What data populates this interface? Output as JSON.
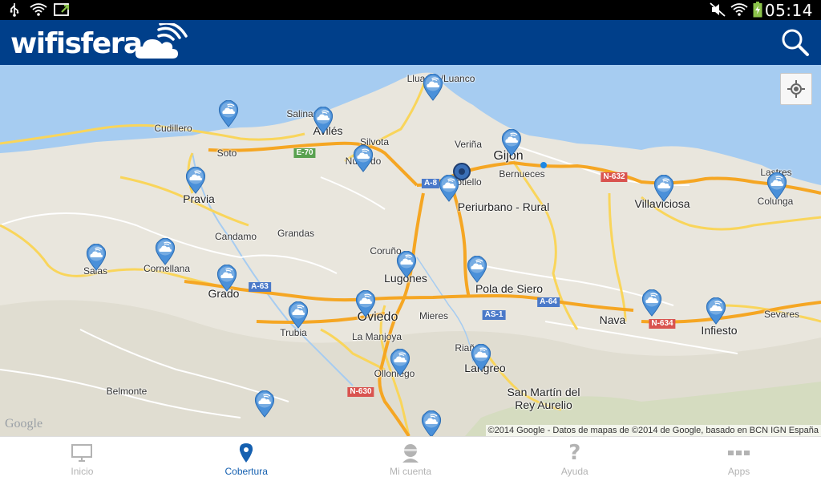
{
  "status_bar": {
    "time": "05:14",
    "left_icons": [
      "usb-icon",
      "wifi-alert-icon",
      "screen-share-icon"
    ],
    "right_icons": [
      "mute-icon",
      "wifi-icon",
      "battery-charging-icon"
    ]
  },
  "app_bar": {
    "logo_text": "wifisfera",
    "logo_icon": "wifi-cloud-icon",
    "search_icon": "search-icon",
    "color": "#003f8a"
  },
  "map": {
    "places": [
      {
        "name": "Lluanco/Luanco",
        "size": "normal"
      },
      {
        "name": "Salinas",
        "size": "normal"
      },
      {
        "name": "Avilés",
        "size": "big"
      },
      {
        "name": "Cudillero",
        "size": "normal"
      },
      {
        "name": "Silvota",
        "size": "normal"
      },
      {
        "name": "Veriña",
        "size": "normal"
      },
      {
        "name": "Gijón",
        "size": "xl"
      },
      {
        "name": "Soto",
        "size": "normal"
      },
      {
        "name": "Bernueces",
        "size": "normal"
      },
      {
        "name": "Lastres",
        "size": "normal"
      },
      {
        "name": "Nubledo",
        "size": "normal"
      },
      {
        "name": "Sotiello",
        "size": "normal"
      },
      {
        "name": "Pravia",
        "size": "big"
      },
      {
        "name": "Periurbano - Rural",
        "size": "big"
      },
      {
        "name": "Villaviciosa",
        "size": "big"
      },
      {
        "name": "Colunga",
        "size": "normal"
      },
      {
        "name": "Candamo",
        "size": "normal"
      },
      {
        "name": "Grandas",
        "size": "normal"
      },
      {
        "name": "Coruño",
        "size": "normal"
      },
      {
        "name": "Salas",
        "size": "normal"
      },
      {
        "name": "Cornellana",
        "size": "normal"
      },
      {
        "name": "Lugones",
        "size": "big"
      },
      {
        "name": "Pola de Siero",
        "size": "big"
      },
      {
        "name": "Grado",
        "size": "big"
      },
      {
        "name": "Mieres",
        "size": "normal"
      },
      {
        "name": "Oviedo",
        "size": "xl"
      },
      {
        "name": "Nava",
        "size": "big"
      },
      {
        "name": "Sevares",
        "size": "normal"
      },
      {
        "name": "Infiesto",
        "size": "big"
      },
      {
        "name": "Trubia",
        "size": "normal"
      },
      {
        "name": "La Manjoya",
        "size": "normal"
      },
      {
        "name": "Riaño",
        "size": "normal"
      },
      {
        "name": "Langreo",
        "size": "big"
      },
      {
        "name": "Olloniego",
        "size": "normal"
      },
      {
        "name": "Belmonte",
        "size": "normal"
      },
      {
        "name": "San Martín del",
        "size": "big"
      },
      {
        "name": "Rey Aurelio",
        "size": "big"
      }
    ],
    "roads": [
      {
        "label": "E-70",
        "color": "green"
      },
      {
        "label": "A-8",
        "color": "blue"
      },
      {
        "label": "N-632",
        "color": "red"
      },
      {
        "label": "A-63",
        "color": "blue"
      },
      {
        "label": "A-64",
        "color": "blue"
      },
      {
        "label": "AS-1",
        "color": "blue"
      },
      {
        "label": "N-634",
        "color": "red"
      },
      {
        "label": "N-630",
        "color": "red"
      }
    ],
    "pin_count": 24,
    "pin_icon": "wifi-cloud-pin-icon",
    "locate_icon": "my-location-icon",
    "google_logo": "Google",
    "copyright": "©2014 Google - Datos de mapas de ©2014 de Google, basado en BCN IGN España"
  },
  "bottom_nav": {
    "items": [
      {
        "label": "Inicio",
        "icon": "monitor-icon",
        "active": false
      },
      {
        "label": "Cobertura",
        "icon": "map-pin-icon",
        "active": true
      },
      {
        "label": "Mi cuenta",
        "icon": "user-icon",
        "active": false
      },
      {
        "label": "Ayuda",
        "icon": "help-icon",
        "active": false
      },
      {
        "label": "Apps",
        "icon": "apps-grid-icon",
        "active": false
      }
    ],
    "active_color": "#1560b0",
    "inactive_color": "#b3b3b3"
  }
}
